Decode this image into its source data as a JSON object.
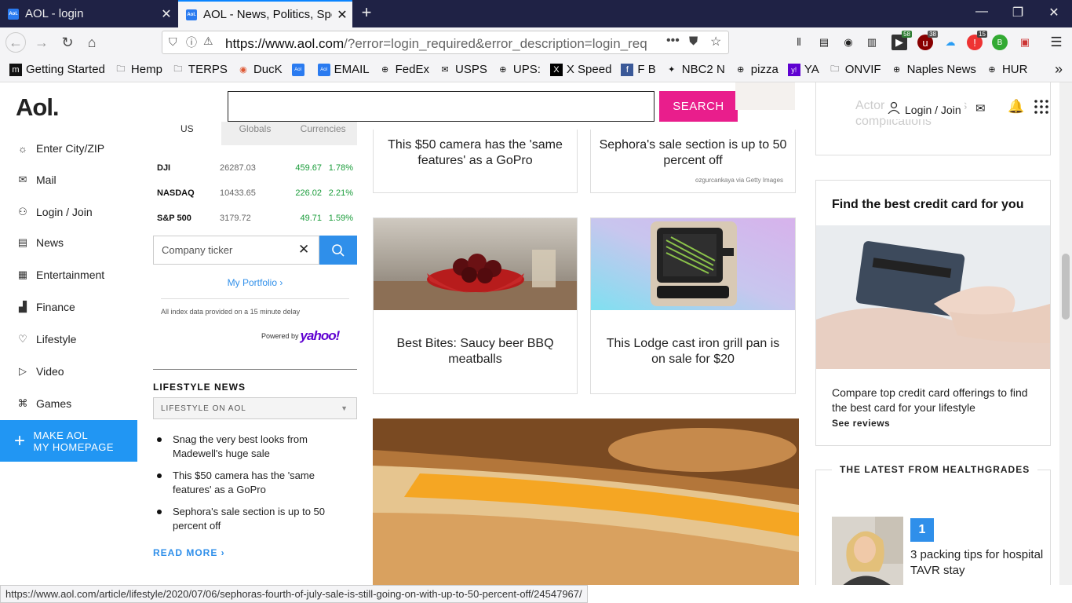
{
  "browser": {
    "tabs": [
      {
        "title": "AOL - login",
        "favicon": "Aol."
      },
      {
        "title": "AOL - News, Politics, Spo",
        "favicon": "Aol."
      }
    ],
    "url_host": "https://www.aol.com",
    "url_rest": "/?error=login_required&error_description=login_req",
    "extension_badges": [
      "58",
      "38",
      "15"
    ],
    "extension_letters": [
      "B"
    ],
    "bookmarks": [
      {
        "label": "Getting Started",
        "icon": "m-icon"
      },
      {
        "label": "Hemp",
        "icon": "folder-icon"
      },
      {
        "label": "TERPS",
        "icon": "folder-icon"
      },
      {
        "label": "DucK",
        "icon": "duckduckgo-icon"
      },
      {
        "label": "",
        "icon": "aol-icon"
      },
      {
        "label": "EMAIL",
        "icon": "aol-icon"
      },
      {
        "label": "FedEx",
        "icon": "globe-icon"
      },
      {
        "label": "USPS",
        "icon": "usps-icon"
      },
      {
        "label": "UPS:",
        "icon": "globe-icon"
      },
      {
        "label": "X Speed",
        "icon": "x-icon"
      },
      {
        "label": "F B",
        "icon": "facebook-icon"
      },
      {
        "label": "NBC2 N",
        "icon": "nbc-icon"
      },
      {
        "label": "pizza",
        "icon": "globe-icon"
      },
      {
        "label": "YA",
        "icon": "yahoo-icon"
      },
      {
        "label": "ONVIF",
        "icon": "folder-icon"
      },
      {
        "label": "Naples News",
        "icon": "globe-icon"
      },
      {
        "label": "HUR",
        "icon": "globe-icon"
      }
    ],
    "status_url": "https://www.aol.com/article/lifestyle/2020/07/06/sephoras-fourth-of-july-sale-is-still-going-on-with-up-to-50-percent-off/24547967/"
  },
  "header": {
    "logo": "Aol.",
    "search_button": "SEARCH",
    "login_label": "Login / Join"
  },
  "sidebar": {
    "items": [
      {
        "label": "Enter City/ZIP",
        "icon": "weather-icon"
      },
      {
        "label": "Mail",
        "icon": "mail-icon"
      },
      {
        "label": "Login / Join",
        "icon": "user-icon"
      },
      {
        "label": "News",
        "icon": "news-icon"
      },
      {
        "label": "Entertainment",
        "icon": "entertainment-icon"
      },
      {
        "label": "Finance",
        "icon": "finance-icon"
      },
      {
        "label": "Lifestyle",
        "icon": "heart-icon"
      },
      {
        "label": "Video",
        "icon": "play-icon"
      },
      {
        "label": "Games",
        "icon": "gamepad-icon"
      }
    ],
    "make_home_line1": "MAKE AOL",
    "make_home_line2": "MY HOMEPAGE"
  },
  "markets": {
    "tabs": [
      "US",
      "Globals",
      "Currencies"
    ],
    "rows": [
      {
        "name": "DJI",
        "value": "26287.03",
        "change": "459.67",
        "pct": "1.78%"
      },
      {
        "name": "NASDAQ",
        "value": "10433.65",
        "change": "226.02",
        "pct": "2.21%"
      },
      {
        "name": "S&P 500",
        "value": "3179.72",
        "change": "49.71",
        "pct": "1.59%"
      }
    ],
    "ticker_placeholder": "Company ticker",
    "portfolio": "My Portfolio ›",
    "delay_note": "All index data provided on a 15 minute delay",
    "powered_by": "Powered by",
    "powered_brand": "yahoo!"
  },
  "lifestyle": {
    "heading": "LIFESTYLE NEWS",
    "select": "LIFESTYLE ON AOL",
    "items": [
      "Snag the very best looks from Madewell's huge sale",
      "This $50 camera has the 'same features' as a GoPro",
      "Sephora's sale section is up to 50 percent off"
    ],
    "read_more": "READ MORE ›"
  },
  "cards": {
    "camera": "This $50 camera has the 'same features' as a GoPro",
    "sephora": "Sephora's sale section is up to 50 percent off",
    "sephora_credit": "ozgurcankaya via Getty Images",
    "meatballs": "Best Bites: Saucy beer BBQ meatballs",
    "lodge": "This Lodge cast iron grill pan is on sale for $20"
  },
  "right": {
    "top_faded": "Actor ... coronavirus complications",
    "cc_title": "Find the best credit card for you",
    "cc_text": "Compare top credit card offerings to find the best card for your lifestyle",
    "cc_link": "See reviews",
    "hg_title": "THE LATEST FROM HEALTHGRADES",
    "hg_num": "1",
    "hg_text": "3 packing tips for hospital TAVR stay"
  }
}
